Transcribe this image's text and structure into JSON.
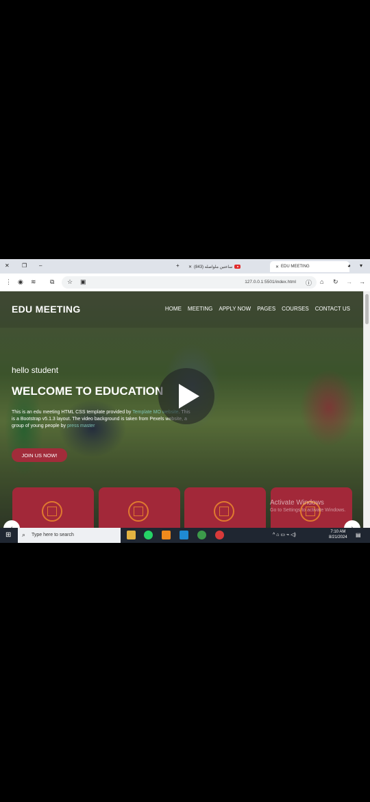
{
  "browser": {
    "tabs": [
      {
        "label": "(843) ساعتين ملواصله",
        "active": false
      },
      {
        "label": "EDU MEETING",
        "active": true
      }
    ],
    "url": "127.0.0.1:5501/index.html"
  },
  "site": {
    "logo": "EDU MEETING",
    "nav": [
      "HOME",
      "MEETING",
      "APPLY NOW",
      "PAGES",
      "COURSES",
      "CONTACT US"
    ],
    "greeting": "hello student",
    "headline": "WELCOME TO EDUCATION",
    "desc_part1": "This is an edu meeting HTML CSS template provided by ",
    "desc_link1": "Template MO website",
    "desc_part2": ". This is a Bootstrap v5.1.3 layout. The video background is taken from Pexels website, a group of young people by ",
    "desc_link2": "press master",
    "join_label": "JOIN US NOW!"
  },
  "watermark": {
    "title": "Activate Windows",
    "subtitle": "Go to Settings to activate Windows."
  },
  "taskbar": {
    "search_placeholder": "Type here to search",
    "time": "7:10 AM",
    "date": "8/21/2024"
  }
}
